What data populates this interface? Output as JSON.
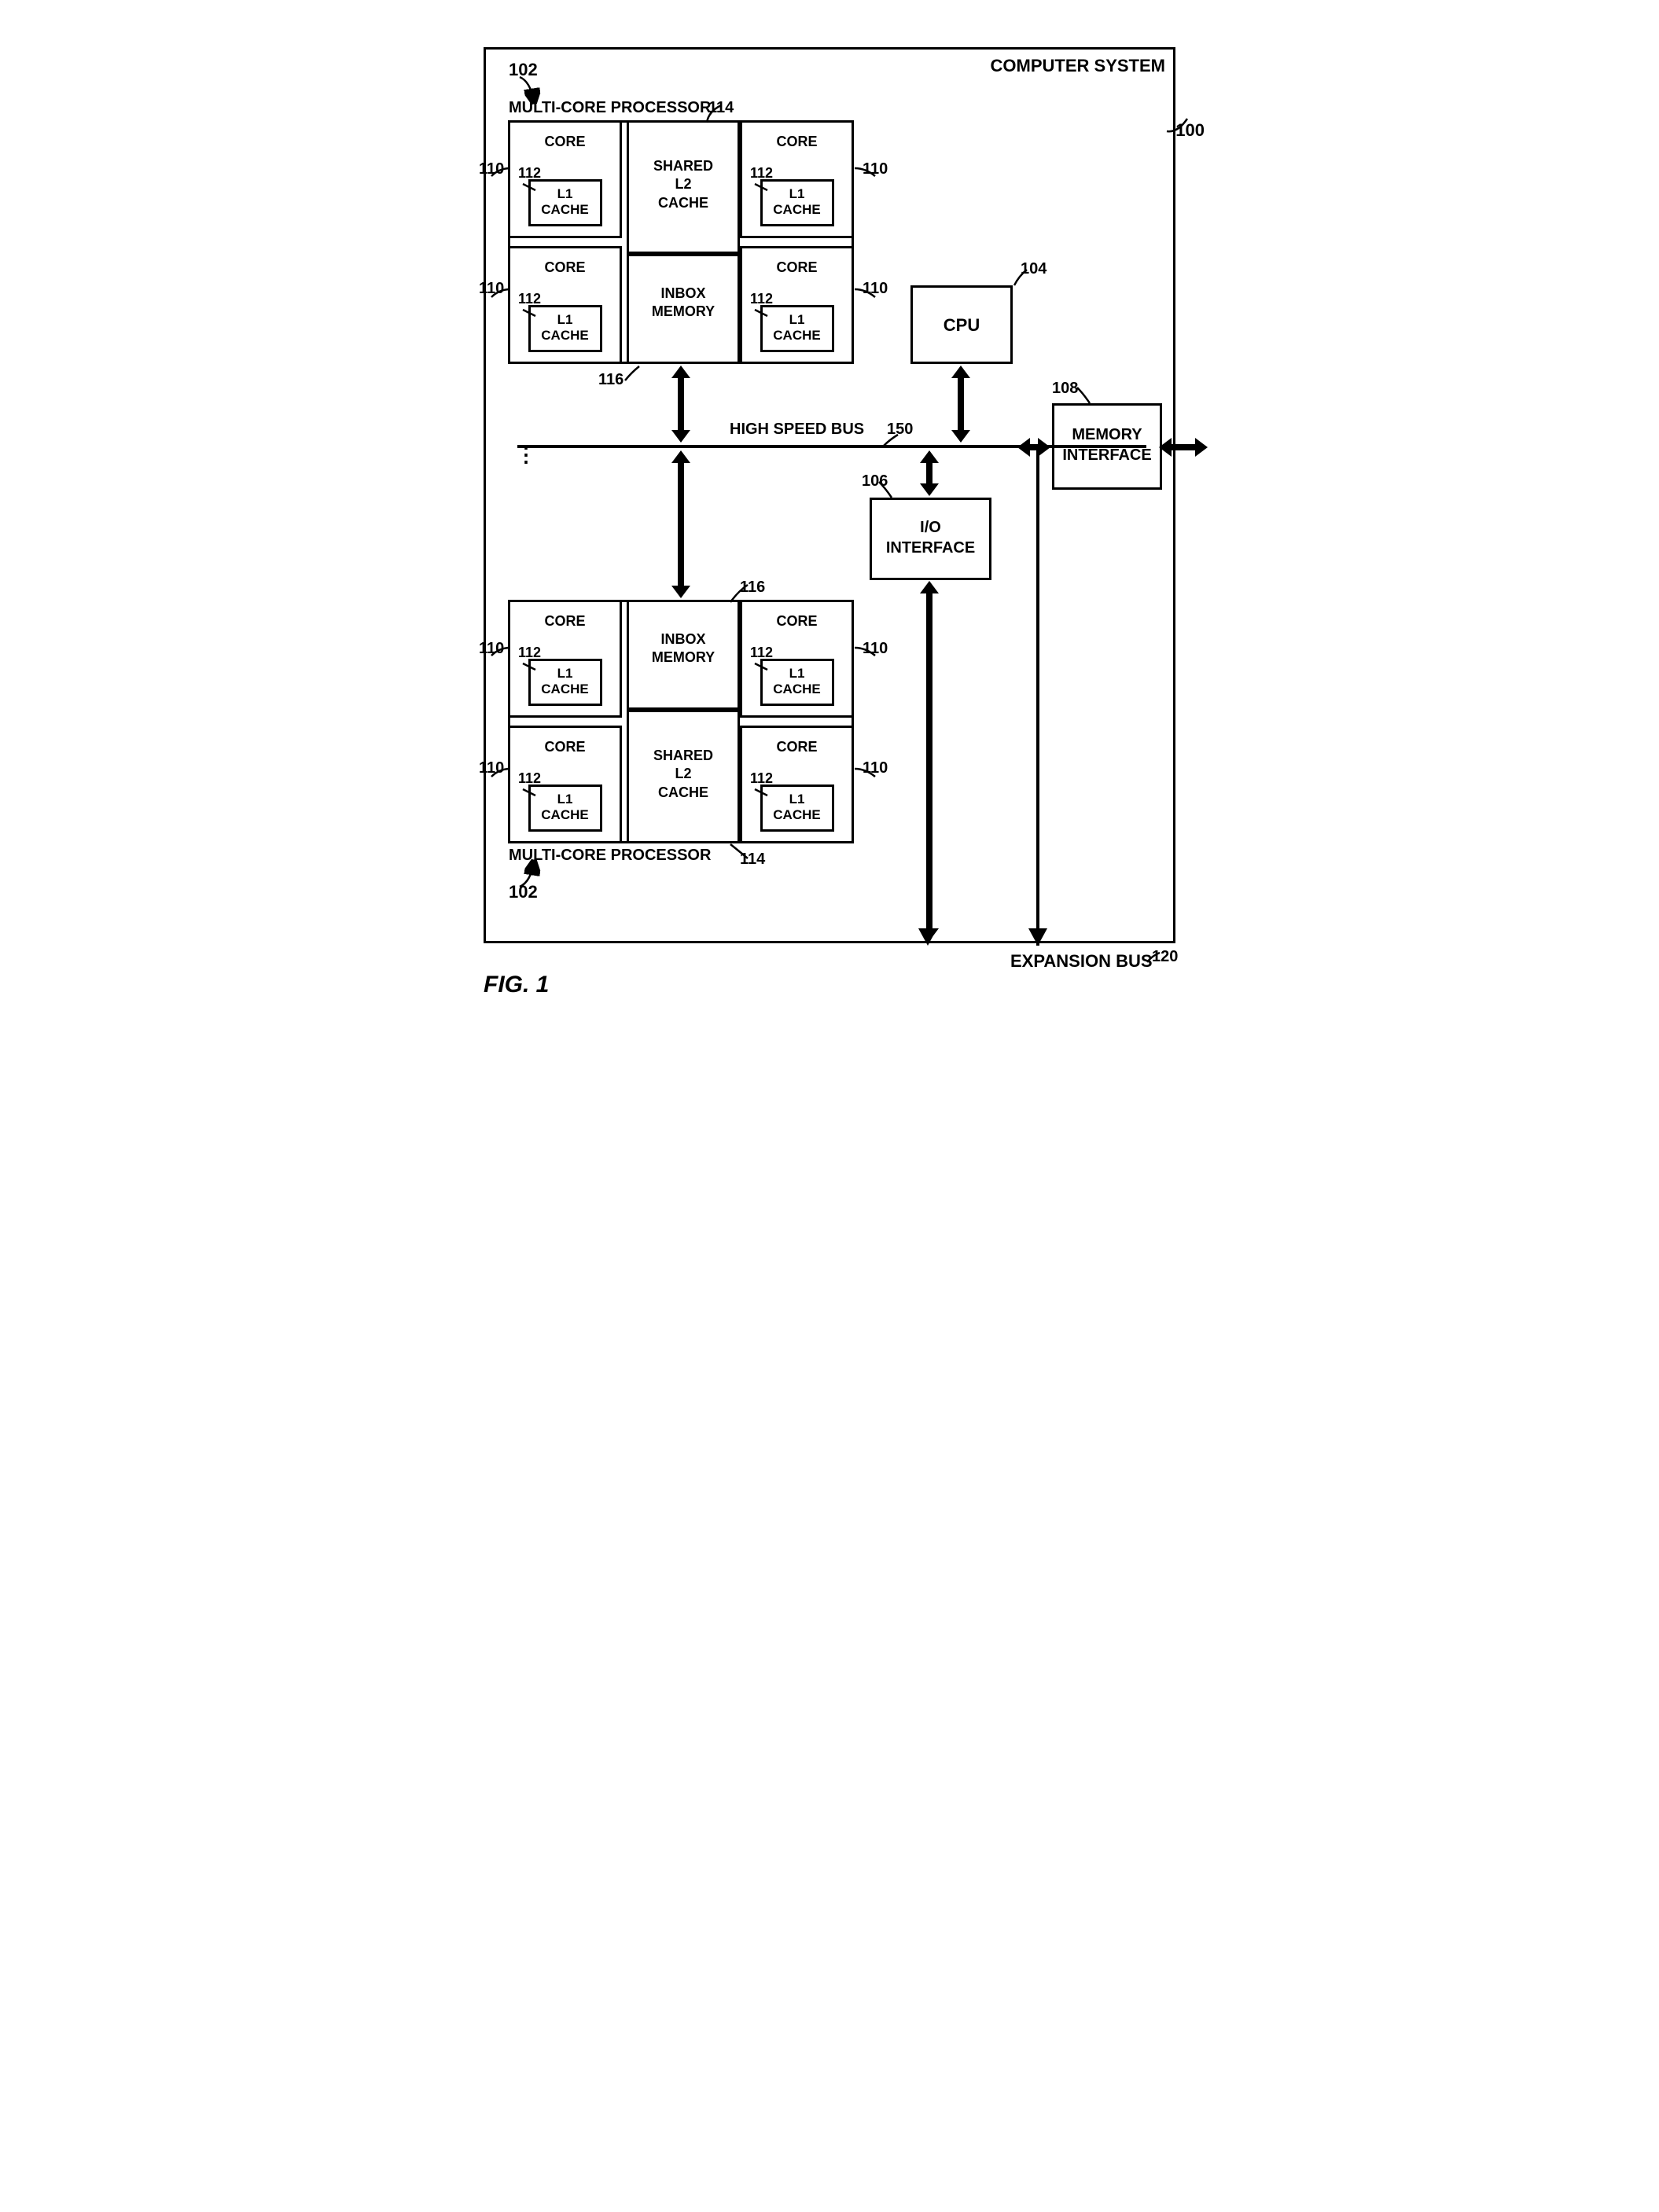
{
  "figure_label": "FIG. 1",
  "system_label": "COMPUTER SYSTEM",
  "ref": {
    "system": "100",
    "mcp": "102",
    "cpu": "104",
    "io": "106",
    "mem": "108",
    "core": "110",
    "l1": "112",
    "l2": "114",
    "inbox": "116",
    "expbus": "120",
    "hsbus": "150"
  },
  "labels": {
    "mcp": "MULTI-CORE PROCESSOR",
    "core": "CORE",
    "l1_line1": "L1",
    "l1_line2": "CACHE",
    "l2_line1": "SHARED",
    "l2_line2": "L2",
    "l2_line3": "CACHE",
    "inbox_line1": "INBOX",
    "inbox_line2": "MEMORY",
    "cpu": "CPU",
    "mem_line1": "MEMORY",
    "mem_line2": "INTERFACE",
    "io_line1": "I/O",
    "io_line2": "INTERFACE",
    "hs_bus": "HIGH SPEED BUS",
    "exp_bus": "EXPANSION BUS"
  }
}
